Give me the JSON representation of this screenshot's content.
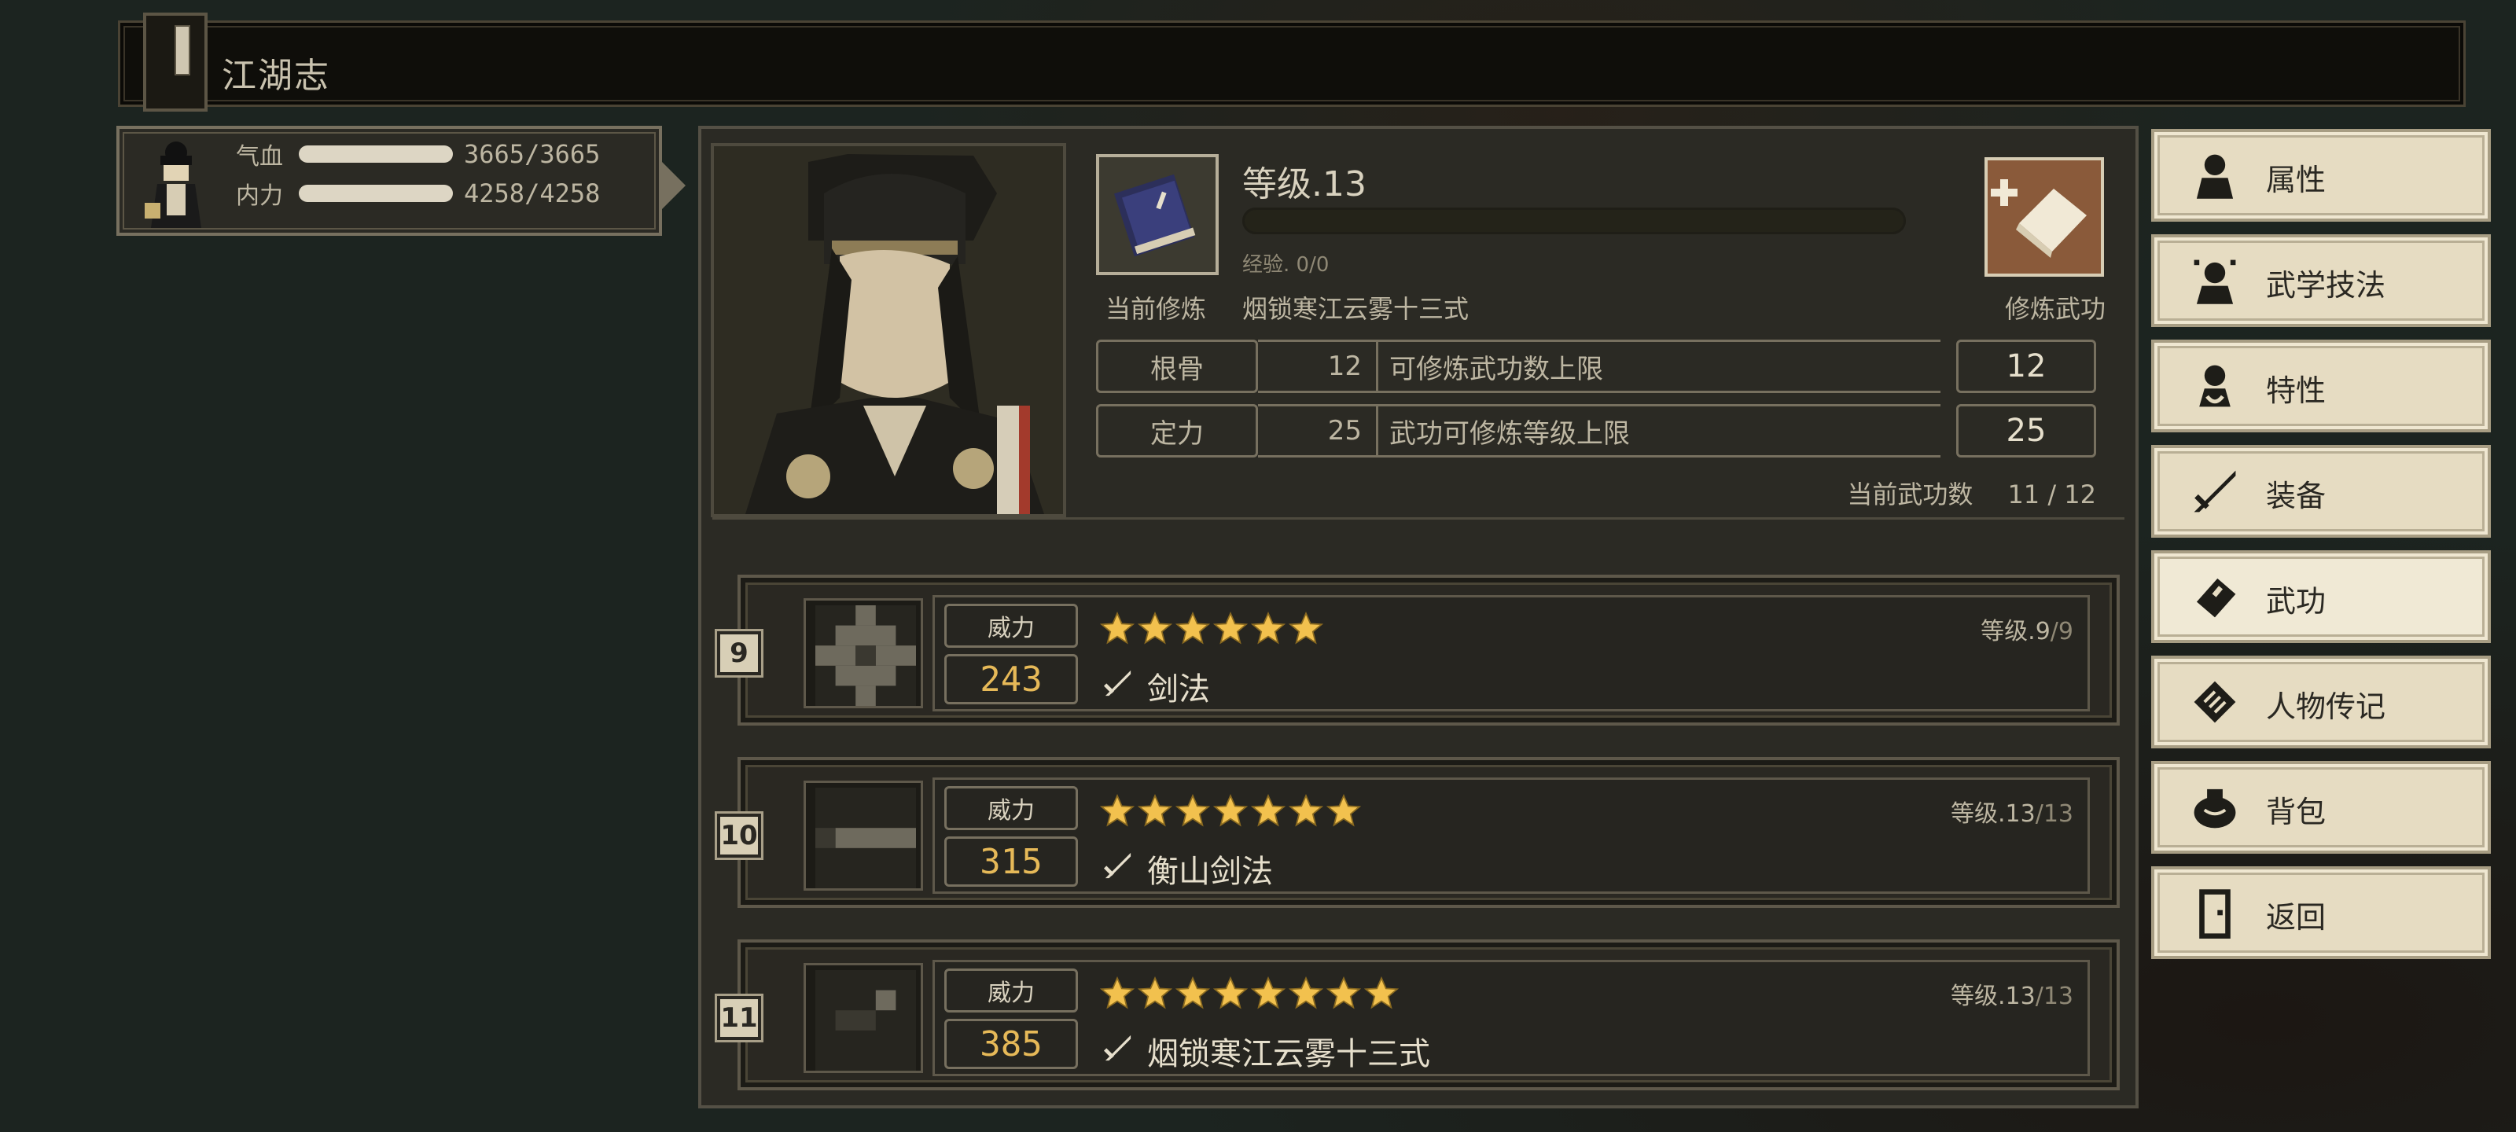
{
  "header": {
    "title": "江湖志"
  },
  "player": {
    "hp_label": "气血",
    "hp_value": "3665/3665",
    "mp_label": "内力",
    "mp_value": "4258/4258"
  },
  "info": {
    "level": "等级.13",
    "exp": "经验. 0/0",
    "current_label": "当前修炼",
    "current_name": "烟锁寒江云雾十三式",
    "cultivate_label": "修炼武功",
    "attributes": [
      {
        "name": "根骨",
        "value": "12",
        "desc": "可修炼武功数上限",
        "cap": "12"
      },
      {
        "name": "定力",
        "value": "25",
        "desc": "武功可修炼等级上限",
        "cap": "25"
      }
    ],
    "count_label": "当前武功数",
    "count_value": "11 / 12"
  },
  "skills": [
    {
      "index": "9",
      "power_label": "威力",
      "power": "243",
      "stars": 6,
      "name": "剑法",
      "level": "等级.9",
      "level_max": "/9"
    },
    {
      "index": "10",
      "power_label": "威力",
      "power": "315",
      "stars": 7,
      "name": "衡山剑法",
      "level": "等级.13",
      "level_max": "/13"
    },
    {
      "index": "11",
      "power_label": "威力",
      "power": "385",
      "stars": 8,
      "name": "烟锁寒江云雾十三式",
      "level": "等级.13",
      "level_max": "/13"
    }
  ],
  "menu": [
    {
      "label": "属性",
      "icon": "character-icon"
    },
    {
      "label": "武学技法",
      "icon": "martial-technique-icon"
    },
    {
      "label": "特性",
      "icon": "trait-icon"
    },
    {
      "label": "装备",
      "icon": "sword-icon"
    },
    {
      "label": "武功",
      "icon": "manual-book-icon"
    },
    {
      "label": "人物传记",
      "icon": "biography-icon"
    },
    {
      "label": "背包",
      "icon": "bag-icon"
    },
    {
      "label": "返回",
      "icon": "door-icon"
    }
  ],
  "colors": {
    "accent": "#e6b958",
    "panel": "#2b2a24",
    "menu": "#e6dcc2",
    "cultivate": "#8a5a3a"
  }
}
